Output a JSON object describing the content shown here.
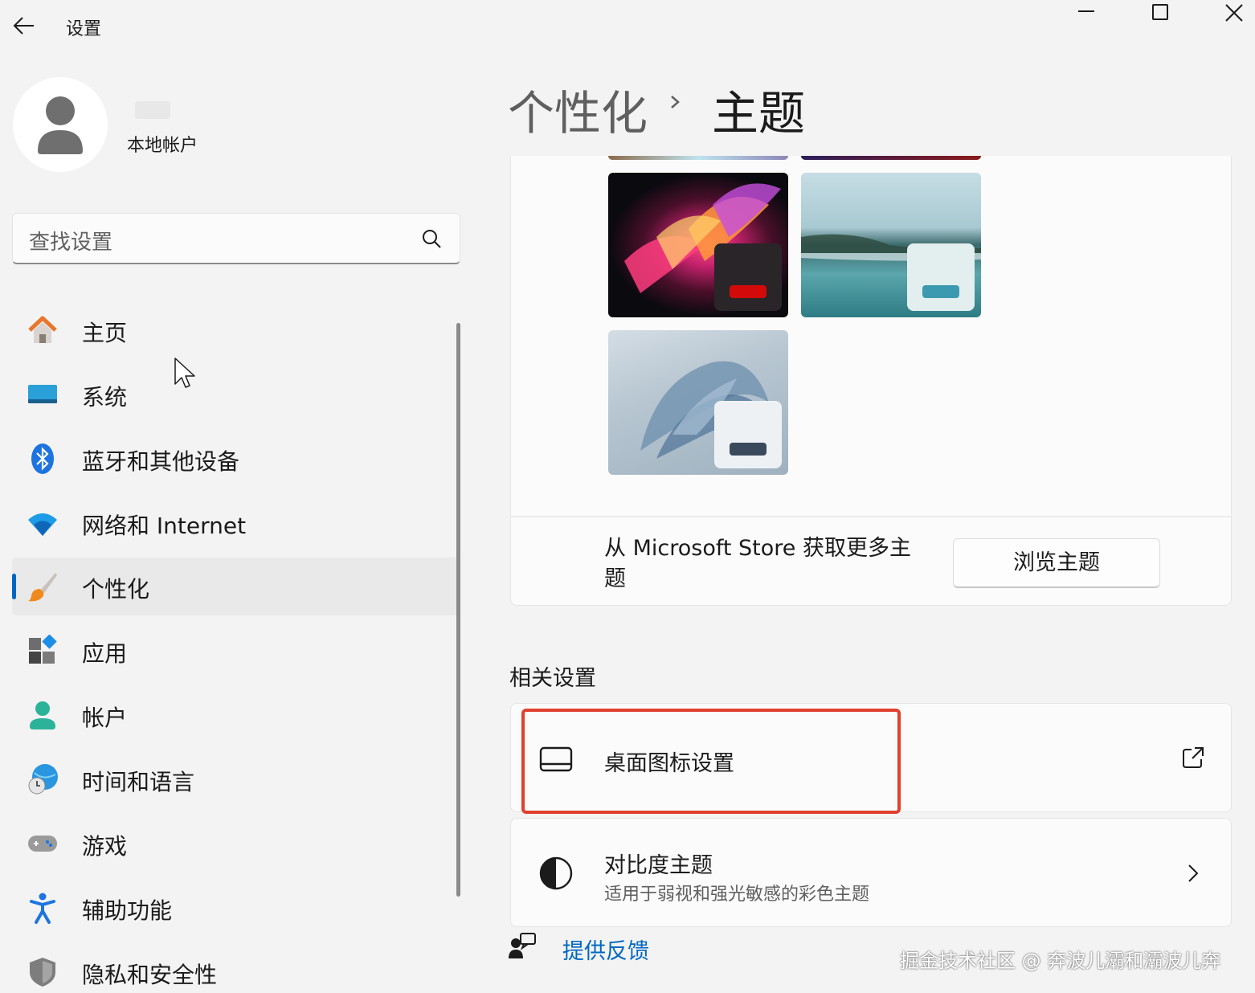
{
  "window": {
    "title": "设置"
  },
  "account": {
    "type": "本地帐户"
  },
  "search": {
    "placeholder": "查找设置"
  },
  "nav": [
    {
      "label": "主页",
      "icon": "home-icon"
    },
    {
      "label": "系统",
      "icon": "system-icon"
    },
    {
      "label": "蓝牙和其他设备",
      "icon": "bluetooth-icon"
    },
    {
      "label": "网络和 Internet",
      "icon": "wifi-icon"
    },
    {
      "label": "个性化",
      "icon": "brush-icon",
      "selected": true
    },
    {
      "label": "应用",
      "icon": "apps-icon"
    },
    {
      "label": "帐户",
      "icon": "account-icon"
    },
    {
      "label": "时间和语言",
      "icon": "globe-clock-icon"
    },
    {
      "label": "游戏",
      "icon": "gamepad-icon"
    },
    {
      "label": "辅助功能",
      "icon": "accessibility-icon"
    },
    {
      "label": "隐私和安全性",
      "icon": "shield-icon"
    }
  ],
  "header": {
    "parent": "个性化",
    "current": "主题"
  },
  "themes": [
    {
      "name": "glow-theme",
      "accent": "#d20a0a"
    },
    {
      "name": "lake-theme",
      "accent": "#3c9ab0"
    },
    {
      "name": "bloom-theme",
      "accent": "#3a4a5c"
    }
  ],
  "store": {
    "text": "从 Microsoft Store 获取更多主题",
    "button": "浏览主题"
  },
  "related": {
    "title": "相关设置",
    "desktop_icons": {
      "title": "桌面图标设置"
    },
    "contrast": {
      "title": "对比度主题",
      "subtitle": "适用于弱视和强光敏感的彩色主题"
    }
  },
  "feedback": {
    "label": "提供反馈"
  },
  "watermark": "掘金技术社区 @ 奔波儿灞和灞波儿奔",
  "colors": {
    "accent": "#0067c0",
    "highlight": "#e0402e"
  }
}
